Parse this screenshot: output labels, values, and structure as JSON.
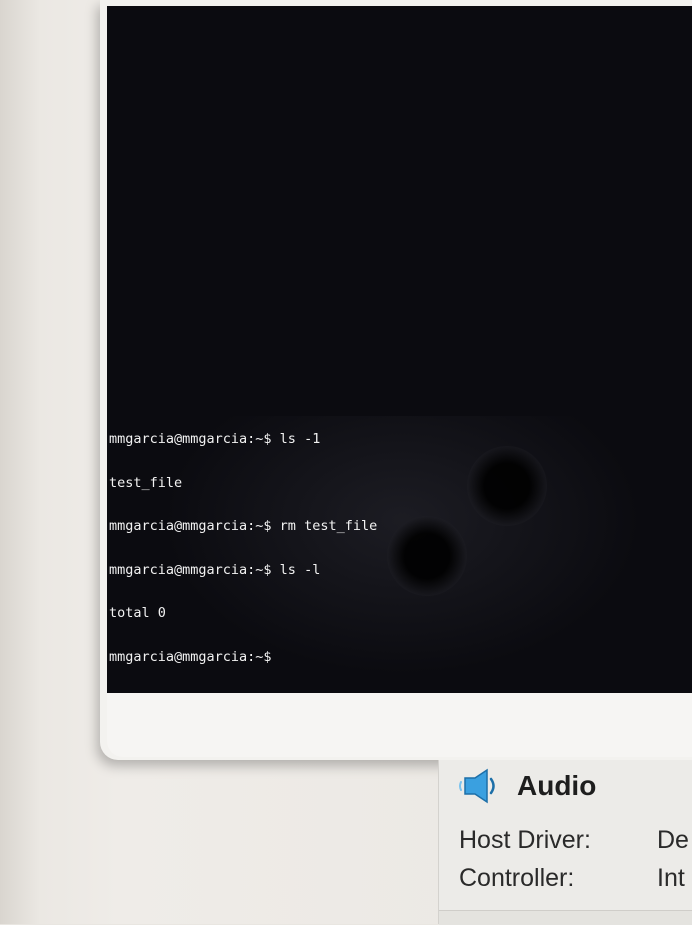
{
  "terminal": {
    "lines": [
      "mmgarcia@mmgarcia:~$ ls -1",
      "test_file",
      "mmgarcia@mmgarcia:~$ rm test_file",
      "mmgarcia@mmgarcia:~$ ls -l",
      "total 0",
      "mmgarcia@mmgarcia:~$"
    ]
  },
  "details": {
    "audio": {
      "icon": "speaker-icon",
      "title": "Audio",
      "host_driver_label": "Host Driver:",
      "host_driver_value": "De",
      "controller_label": "Controller:",
      "controller_value": "Int"
    }
  },
  "colors": {
    "terminal_bg": "#0b0b10",
    "terminal_fg": "#f2f2f2",
    "speaker_blue": "#3aa0e0"
  }
}
